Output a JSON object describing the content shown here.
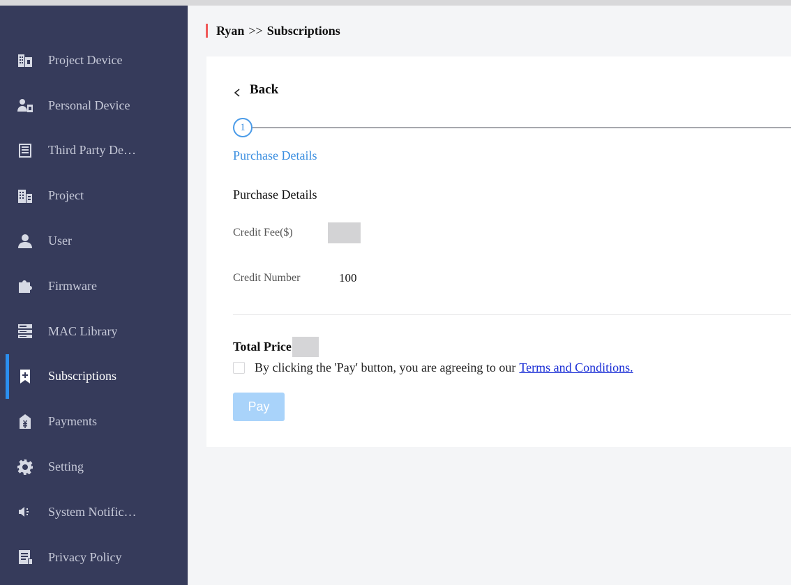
{
  "sidebar": {
    "items": [
      {
        "label": "Project Device",
        "icon": "building-device-icon",
        "active": false
      },
      {
        "label": "Personal Device",
        "icon": "person-device-icon",
        "active": false
      },
      {
        "label": "Third Party De…",
        "icon": "list-panel-icon",
        "active": false
      },
      {
        "label": "Project",
        "icon": "building-icon",
        "active": false
      },
      {
        "label": "User",
        "icon": "user-icon",
        "active": false
      },
      {
        "label": "Firmware",
        "icon": "puzzle-icon",
        "active": false
      },
      {
        "label": "MAC Library",
        "icon": "server-icon",
        "active": false
      },
      {
        "label": "Subscriptions",
        "icon": "bookmark-plus-icon",
        "active": true
      },
      {
        "label": "Payments",
        "icon": "yen-bag-icon",
        "active": false
      },
      {
        "label": "Setting",
        "icon": "gear-icon",
        "active": false
      },
      {
        "label": "System Notific…",
        "icon": "speaker-icon",
        "active": false
      },
      {
        "label": "Privacy Policy",
        "icon": "document-icon",
        "active": false
      }
    ]
  },
  "breadcrumb": {
    "parent": "Ryan",
    "separator": ">>",
    "current": "Subscriptions"
  },
  "content": {
    "back_label": "Back",
    "step_number": "1",
    "step_label": "Purchase Details",
    "section_title": "Purchase Details",
    "credit_fee_label": "Credit Fee($)",
    "credit_number_label": "Credit Number",
    "credit_number_value": "100",
    "total_price_label": "Total Price",
    "agree_text": "By clicking the 'Pay' button, you are agreeing to our",
    "terms_link": "Terms and Conditions.",
    "pay_label": "Pay"
  },
  "colors": {
    "sidebar_bg": "#363b5b",
    "accent": "#2b8ff0",
    "breadcrumb_marker": "#f05a5a",
    "pay_button_disabled": "#a9d3fa",
    "link": "#1b2fd6"
  }
}
